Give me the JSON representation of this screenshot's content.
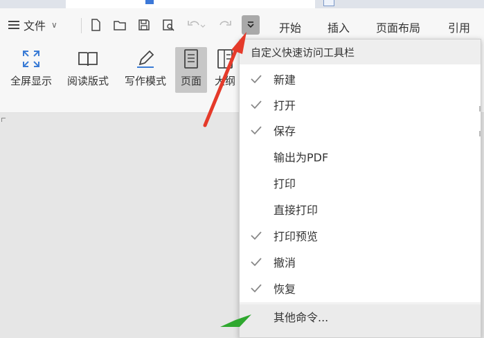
{
  "header": {
    "file_menu_label": "文件",
    "menu_tabs": [
      "开始",
      "插入",
      "页面布局",
      "引用"
    ]
  },
  "ribbon": {
    "buttons": [
      "全屏显示",
      "阅读版式",
      "写作模式",
      "页面",
      "大纲"
    ]
  },
  "quick_access_menu": {
    "title": "自定义快速访问工具栏",
    "items": [
      {
        "label": "新建",
        "checked": true
      },
      {
        "label": "打开",
        "checked": true
      },
      {
        "label": "保存",
        "checked": true
      },
      {
        "label": "输出为PDF",
        "checked": false
      },
      {
        "label": "打印",
        "checked": false
      },
      {
        "label": "直接打印",
        "checked": false
      },
      {
        "label": "打印预览",
        "checked": true
      },
      {
        "label": "撤消",
        "checked": true
      },
      {
        "label": "恢复",
        "checked": true
      }
    ],
    "more_label": "其他命令..."
  },
  "annotations": {
    "red_arrow_color": "#e53a2a",
    "green_arrow_color": "#2fa82f"
  }
}
